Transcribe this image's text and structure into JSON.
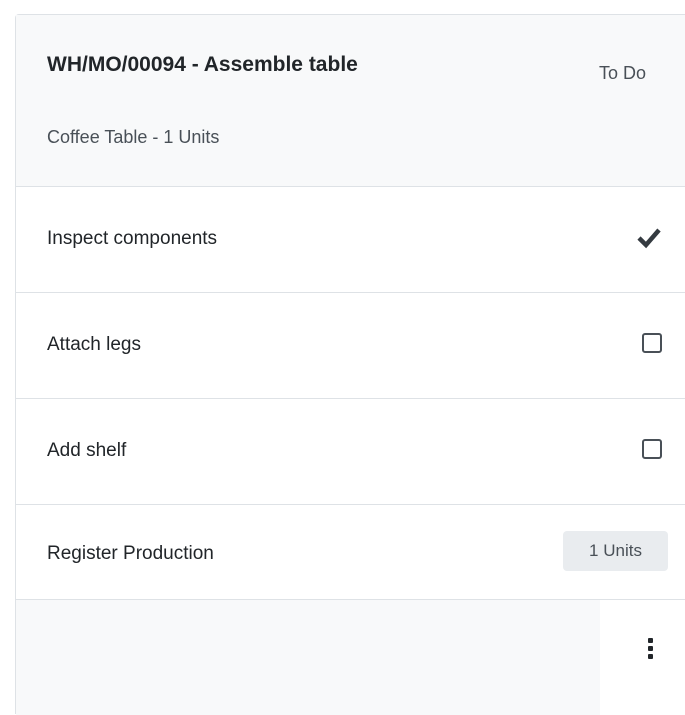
{
  "header": {
    "title": "WH/MO/00094 - Assemble table",
    "status": "To Do",
    "subtitle": "Coffee Table - 1 Units"
  },
  "steps": [
    {
      "label": "Inspect components",
      "state": "done",
      "icon": "checkmark-icon"
    },
    {
      "label": "Attach legs",
      "state": "todo",
      "icon": "checkbox-icon"
    },
    {
      "label": "Add shelf",
      "state": "todo",
      "icon": "checkbox-icon"
    }
  ],
  "production": {
    "label": "Register Production",
    "badge": "1 Units"
  },
  "footer": {
    "menu_icon": "kebab-menu-icon"
  },
  "colors": {
    "header_bg": "#f8f9fa",
    "border": "#dee2e6",
    "text": "#212529",
    "muted": "#495057",
    "badge_bg": "#e9ecef"
  }
}
